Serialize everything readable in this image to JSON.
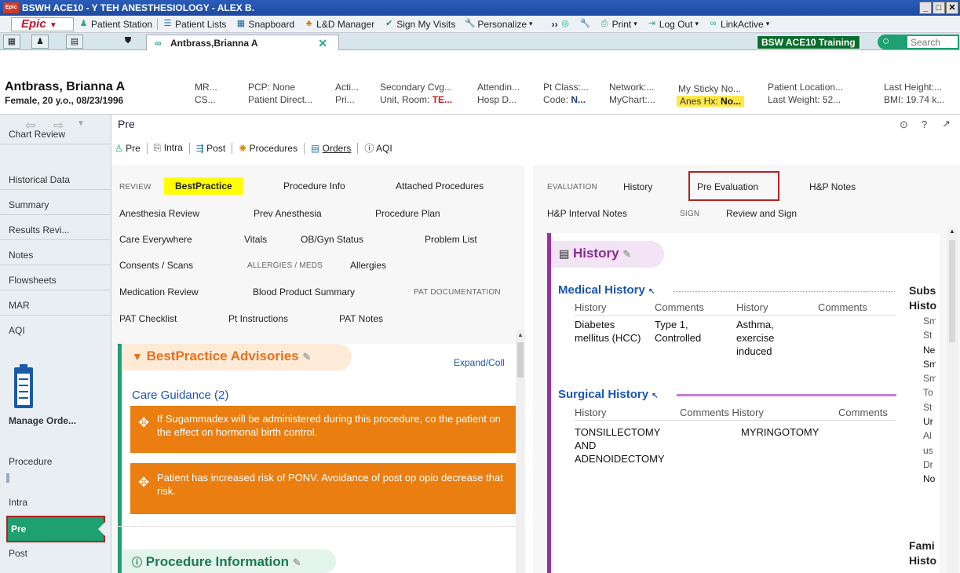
{
  "window": {
    "title": "BSWH ACE10 - Y TEH ANESTHESIOLOGY - ALEX B.",
    "logo_text": "Epic"
  },
  "menubar": {
    "epic_label": "Epic",
    "items": [
      "Patient Station",
      "Patient Lists",
      "Snapboard",
      "L&D Manager",
      "Sign My Visits",
      "Personalize",
      "Print",
      "Log Out",
      "LinkActive"
    ]
  },
  "tabbar": {
    "patient_tab": "Antbrass,Brianna A",
    "env_badge": "BSW ACE10 Training",
    "search_placeholder": "Search"
  },
  "patient": {
    "name": "Antbrass, Brianna A",
    "demographics": "Female, 20 y.o., 08/23/1996",
    "fields": {
      "mr": "MR...",
      "cs": "CS...",
      "pcp": "PCP: None",
      "pt_direct": "Patient Direct...",
      "acti": "Acti...",
      "pri": "Pri...",
      "secondary_cvg": "Secondary Cvg...",
      "unit_room_label": "Unit, Room:",
      "unit_room_value": "TE...",
      "attending": "Attendin...",
      "hosp": "Hosp D...",
      "pt_class": "Pt Class:...",
      "code_label": "Code:",
      "code_value": "N...",
      "network": "Network:...",
      "mychart": "MyChart:...",
      "sticky": "My Sticky No...",
      "anes_label": "Anes Hx:",
      "anes_value": "No...",
      "pt_location": "Patient Location...",
      "last_weight": "Last Weight: 52...",
      "last_height": "Last Height:...",
      "bmi": "BMI: 19.74 k..."
    }
  },
  "sidebar": {
    "items": [
      "Chart Review",
      "Historical Data",
      "Summary",
      "Results Revi...",
      "Notes",
      "Flowsheets",
      "MAR",
      "AQI"
    ],
    "manage_orders": "Manage Orde...",
    "lower_items": [
      "Procedure",
      "Intra",
      "Pre",
      "Post"
    ]
  },
  "activity": {
    "title": "Pre",
    "toolbar": [
      "Pre",
      "Intra",
      "Post",
      "Procedures",
      "Orders",
      "AQI"
    ]
  },
  "left_nav": {
    "review_caption": "REVIEW",
    "allergies_caption": "ALLERGIES / MEDS",
    "pat_caption": "PAT DOCUMENTATION",
    "links": {
      "bestpractice": "BestPractice",
      "procedure_info": "Procedure Info",
      "attached_procedures": "Attached Procedures",
      "anesthesia_review": "Anesthesia Review",
      "prev_anesthesia": "Prev Anesthesia",
      "procedure_plan": "Procedure Plan",
      "care_everywhere": "Care Everywhere",
      "vitals": "Vitals",
      "obgyn_status": "OB/Gyn Status",
      "problem_list": "Problem List",
      "consents_scans": "Consents / Scans",
      "allergies": "Allergies",
      "medication_review": "Medication Review",
      "blood_product_summary": "Blood Product Summary",
      "pat_checklist": "PAT Checklist",
      "pt_instructions": "Pt Instructions",
      "pat_notes": "PAT Notes"
    }
  },
  "bpa": {
    "title": "BestPractice Advisories",
    "expand": "Expand/Coll",
    "care_guidance": "Care Guidance (2)",
    "advisories": [
      "If Sugammadex will be administered during this procedure, co the patient on the effect on hormonal birth control.",
      "Patient has increased risk of PONV. Avoidance of post op opio decrease that risk."
    ],
    "procedure_info_title": "Procedure Information"
  },
  "right_nav": {
    "evaluation_caption": "EVALUATION",
    "sign_caption": "SIGN",
    "links": {
      "history": "History",
      "pre_evaluation": "Pre Evaluation",
      "hp_notes": "H&P Notes",
      "hp_interval": "H&P Interval Notes",
      "review_sign": "Review and Sign"
    }
  },
  "history": {
    "title": "History",
    "medical_title": "Medical History",
    "col_headers": [
      "History",
      "Comments",
      "History",
      "Comments"
    ],
    "medical_rows": [
      {
        "history": "Diabetes mellitus (HCC)",
        "comments": "Type 1, Controlled"
      },
      {
        "history": "Asthma, exercise induced",
        "comments": ""
      }
    ],
    "surgical_title": "Surgical History",
    "surgical_headers": [
      "History",
      "Comments History",
      "Comments"
    ],
    "surgical_rows": [
      "TONSILLECTOMY AND ADENOIDECTOMY",
      "MYRINGOTOMY"
    ],
    "substance_title": "Subs Histo",
    "substance_items": [
      "Sm",
      "St",
      "Ne",
      "Sm",
      "Sm",
      "To",
      "St",
      "Ur",
      "Al",
      "us",
      "Dr",
      "No"
    ],
    "family_title": "Fami Histo"
  }
}
